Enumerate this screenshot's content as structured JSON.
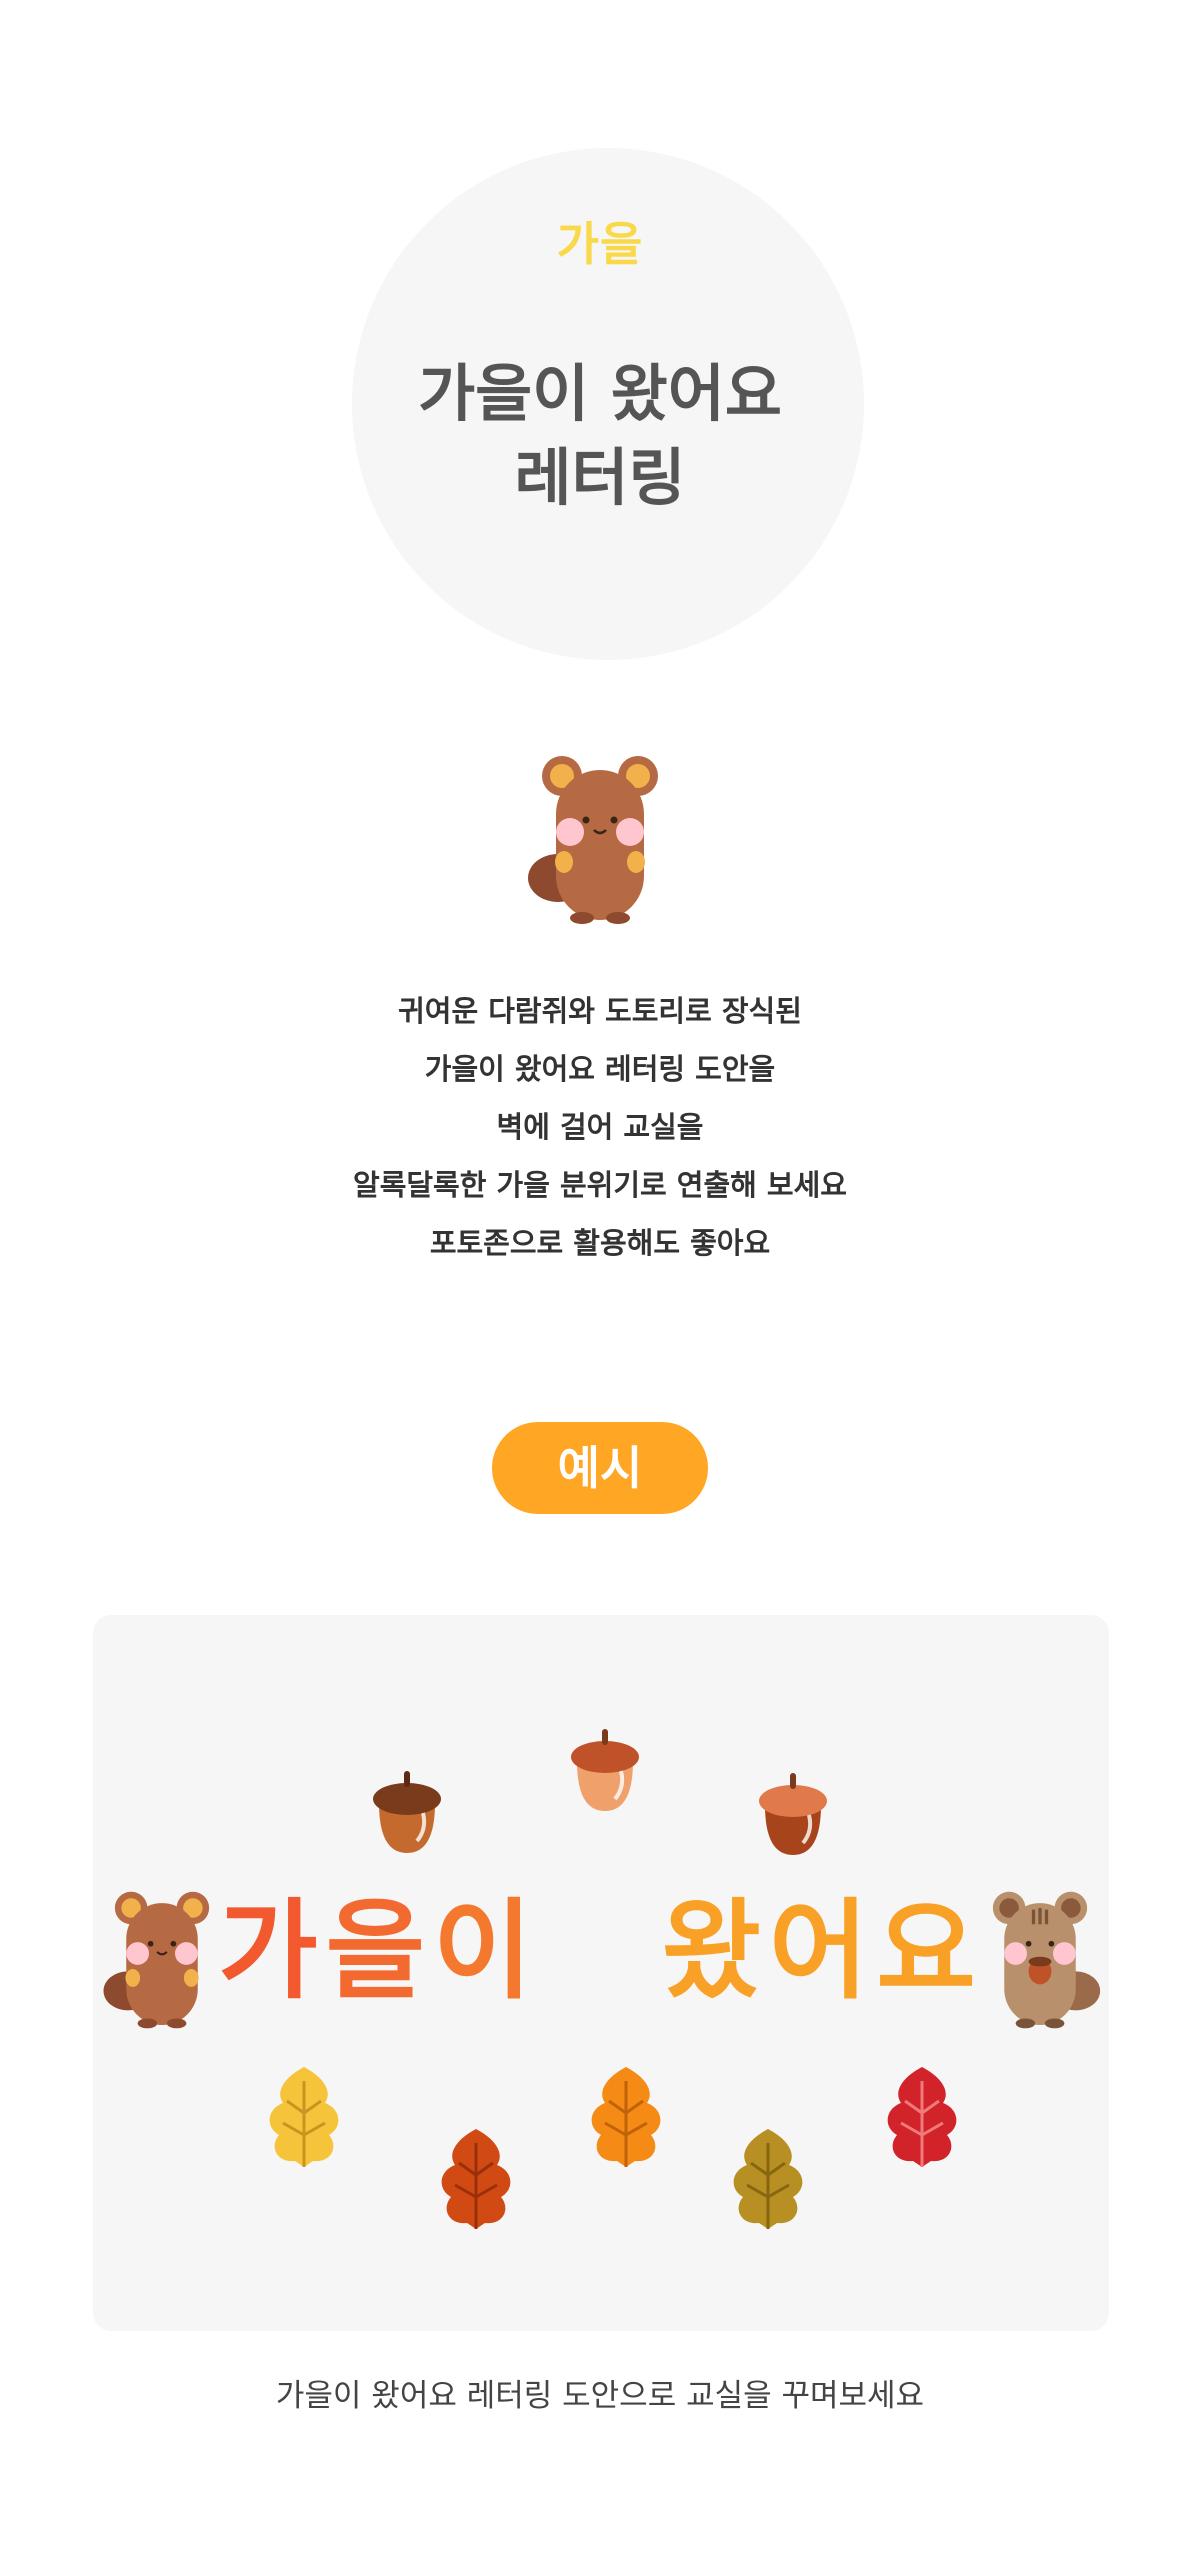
{
  "hero": {
    "category": "가을",
    "title_line1": "가을이 왔어요",
    "title_line2": "레터링"
  },
  "description": [
    "귀여운 다람쥐와 도토리로 장식된",
    "가을이 왔어요 레터링 도안을",
    "벽에 걸어 교실을",
    "알록달록한 가을 분위기로 연출해 보세요",
    "포토존으로 활용해도 좋아요"
  ],
  "example": {
    "badge": "예시",
    "banner_chars": [
      "가",
      "을",
      "이",
      "왔",
      "어",
      "요"
    ],
    "banner_colors": [
      "#f2592e",
      "#f36a30",
      "#f4792e",
      "#f9a126",
      "#f9a126",
      "#f9a126"
    ]
  },
  "caption": "가을이 왔어요 레터링 도안으로 교실을 꾸며보세요",
  "colors": {
    "accent": "#ffa724",
    "category": "#f9d84a",
    "title": "#555555",
    "card_bg": "#f6f6f6"
  },
  "icons": [
    "squirrel-icon",
    "acorn-icon",
    "leaf-icon"
  ]
}
